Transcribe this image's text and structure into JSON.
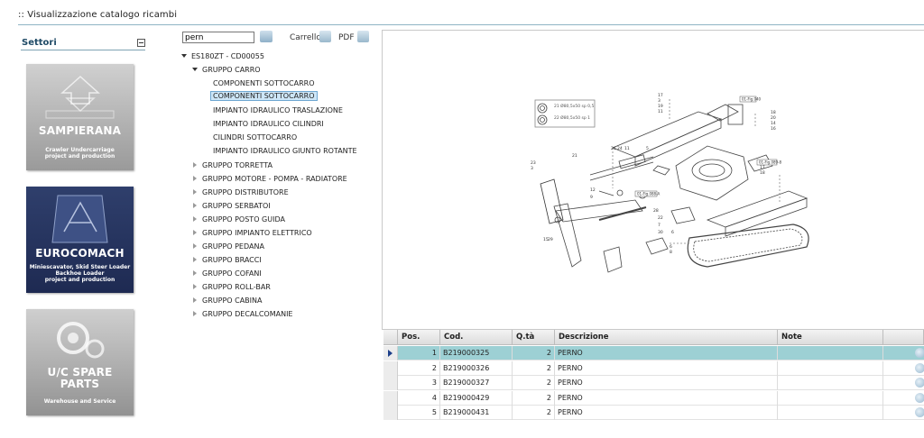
{
  "page": {
    "title": ":: Visualizzazione catalogo ricambi"
  },
  "sidebar": {
    "title": "Settori",
    "logos": [
      {
        "name": "SAMPIERANA",
        "subtitle": "Crawler Undercarriage\nproject and production"
      },
      {
        "name": "EUROCOMACH",
        "subtitle": "Miniescavator, Skid Steer Loader\nBackhoe Loader\nproject and production"
      },
      {
        "name": "U/C SPARE\nPARTS",
        "subtitle": "Warehouse and Service"
      }
    ]
  },
  "toolbar": {
    "search_value": "pern",
    "cart_label": "Carrello",
    "pdf_label": "PDF"
  },
  "tree": {
    "root": "ES180ZT - CD00055",
    "group_open": "GRUPPO CARRO",
    "children": [
      "COMPONENTI SOTTOCARRO",
      "COMPONENTI SOTTOCARRO",
      "IMPIANTO IDRAULICO TRASLAZIONE",
      "IMPIANTO IDRAULICO CILINDRI",
      "CILINDRI SOTTOCARRO",
      "IMPIANTO IDRAULICO GIUNTO ROTANTE"
    ],
    "groups": [
      "GRUPPO TORRETTA",
      "GRUPPO MOTORE - POMPA - RADIATORE",
      "GRUPPO DISTRIBUTORE",
      "GRUPPO SERBATOI",
      "GRUPPO POSTO GUIDA",
      "GRUPPO IMPIANTO ELETTRICO",
      "GRUPPO PEDANA",
      "GRUPPO BRACCI",
      "GRUPPO COFANI",
      "GRUPPO ROLL-BAR",
      "GRUPPO CABINA",
      "GRUPPO DECALCOMANIE"
    ]
  },
  "grid": {
    "headers": {
      "pos": "Pos.",
      "cod": "Cod.",
      "qta": "Q.tà",
      "desc": "Descrizione",
      "note": "Note"
    },
    "rows": [
      {
        "pos": "1",
        "cod": "B219000325",
        "qta": "2",
        "desc": "PERNO",
        "note": ""
      },
      {
        "pos": "2",
        "cod": "B219000326",
        "qta": "2",
        "desc": "PERNO",
        "note": ""
      },
      {
        "pos": "3",
        "cod": "B219000327",
        "qta": "2",
        "desc": "PERNO",
        "note": ""
      },
      {
        "pos": "4",
        "cod": "B219000429",
        "qta": "2",
        "desc": "PERNO",
        "note": ""
      },
      {
        "pos": "5",
        "cod": "B219000431",
        "qta": "2",
        "desc": "PERNO",
        "note": ""
      }
    ]
  },
  "drawing": {
    "callouts": [
      "17",
      "3",
      "19",
      "11",
      "20",
      "18",
      "14",
      "16",
      "26",
      "24",
      "11",
      "5",
      "23",
      "3",
      "12",
      "9",
      "21",
      "28",
      "22",
      "7",
      "30",
      "6",
      "15",
      "29",
      "6",
      "8",
      "17",
      "18"
    ],
    "legend_lines": [
      "21 Ø80,5x50 sp 0,5",
      "22 Ø80,5x50 sp 1"
    ],
    "tags": [
      "01-Fig.040",
      "01-Fig.089-8",
      "01-Fig.088-A"
    ]
  },
  "colors": {
    "accent": "#1f4a66",
    "selection": "#9dd0d4",
    "eurocomach_bg": "#25335e"
  }
}
